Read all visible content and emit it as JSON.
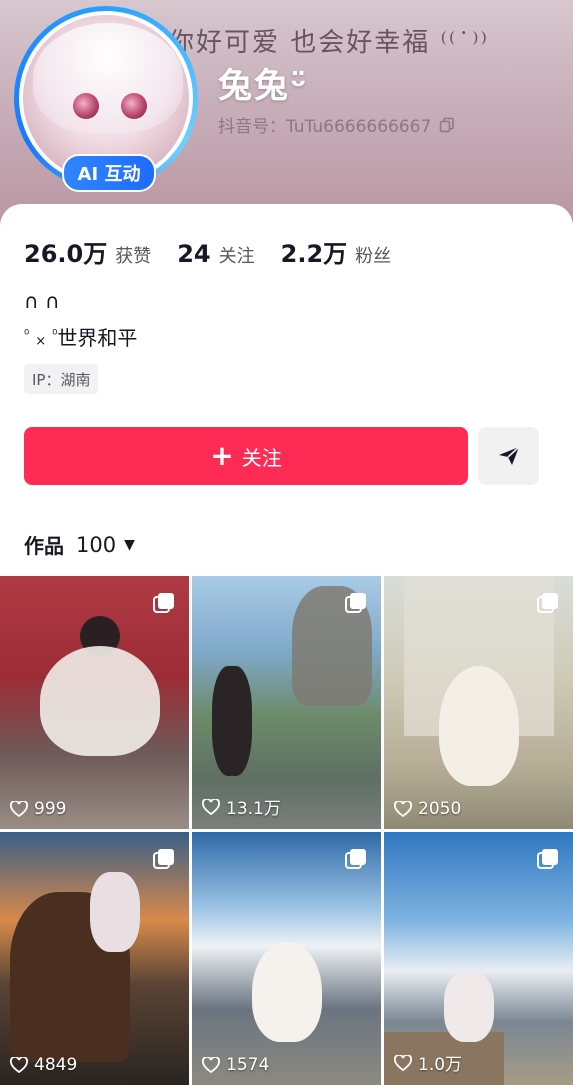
{
  "header": {
    "banner_text": "你好可爱 也会好幸福 ⁽⁽˙⁾⁾",
    "nickname": "兔兔ᵕ̈",
    "douyin_id": "抖音号：TuTu6666666667",
    "ai_badge": "AI 互动"
  },
  "stats": [
    {
      "value": "26.0万",
      "label": "获赞"
    },
    {
      "value": "24",
      "label": "关注"
    },
    {
      "value": "2.2万",
      "label": "粉丝"
    }
  ],
  "bio": {
    "line1": "∩ ∩",
    "line2_prefix": "⁰",
    "line2_x": "×",
    "line2_sup": "⁰",
    "line2_text": "世界和平"
  },
  "ip": "IP：湖南",
  "actions": {
    "follow_label": "关注",
    "follow_plus": "+"
  },
  "works": {
    "label": "作品",
    "count": "100",
    "caret": "▼"
  },
  "videos": [
    {
      "likes": "999"
    },
    {
      "likes": "13.1万"
    },
    {
      "likes": "2050"
    },
    {
      "likes": "4849"
    },
    {
      "likes": "1574"
    },
    {
      "likes": "1.0万"
    }
  ],
  "colors": {
    "accent": "#fe2c55",
    "ai_badge": "#1f6bff",
    "avatar_ring": "#29a0ff"
  },
  "icons": [
    "copy-icon",
    "share-arrow-icon",
    "multi-image-icon",
    "heart-icon",
    "caret-down-icon"
  ]
}
